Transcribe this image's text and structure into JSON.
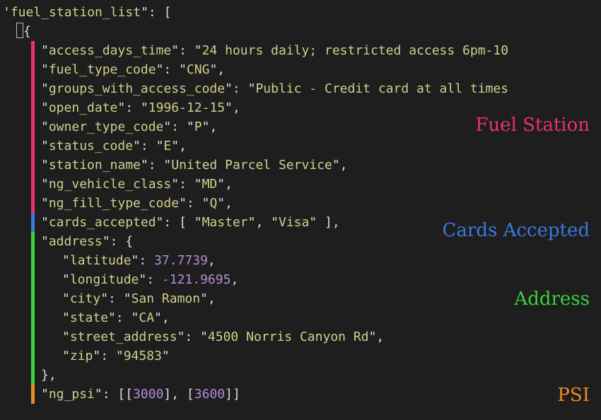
{
  "root_key": "fuel_station_list",
  "station": {
    "access_days_time": "24 hours daily; restricted access 6pm-10",
    "fuel_type_code": "CNG",
    "groups_with_access_code": "Public - Credit card at all times",
    "open_date": "1996-12-15",
    "owner_type_code": "P",
    "status_code": "E",
    "station_name": "United Parcel Service",
    "ng_vehicle_class": "MD",
    "ng_fill_type_code": "Q"
  },
  "cards_accepted": [
    "Master",
    "Visa"
  ],
  "address": {
    "latitude": 37.7739,
    "longitude": -121.9695,
    "city": "San Ramon",
    "state": "CA",
    "street_address": "4500 Norris Canyon Rd",
    "zip": "94583"
  },
  "ng_psi": [
    [
      3000
    ],
    [
      3600
    ]
  ],
  "labels": {
    "fuel_station": "Fuel Station",
    "cards_accepted": "Cards Accepted",
    "address": "Address",
    "psi": "PSI"
  },
  "key_names": {
    "access_days_time": "access_days_time",
    "fuel_type_code": "fuel_type_code",
    "groups_with_access_code": "groups_with_access_code",
    "open_date": "open_date",
    "owner_type_code": "owner_type_code",
    "status_code": "status_code",
    "station_name": "station_name",
    "ng_vehicle_class": "ng_vehicle_class",
    "ng_fill_type_code": "ng_fill_type_code",
    "cards_accepted": "cards_accepted",
    "address": "address",
    "latitude": "latitude",
    "longitude": "longitude",
    "city": "city",
    "state": "state",
    "street_address": "street_address",
    "zip": "zip",
    "ng_psi": "ng_psi"
  }
}
